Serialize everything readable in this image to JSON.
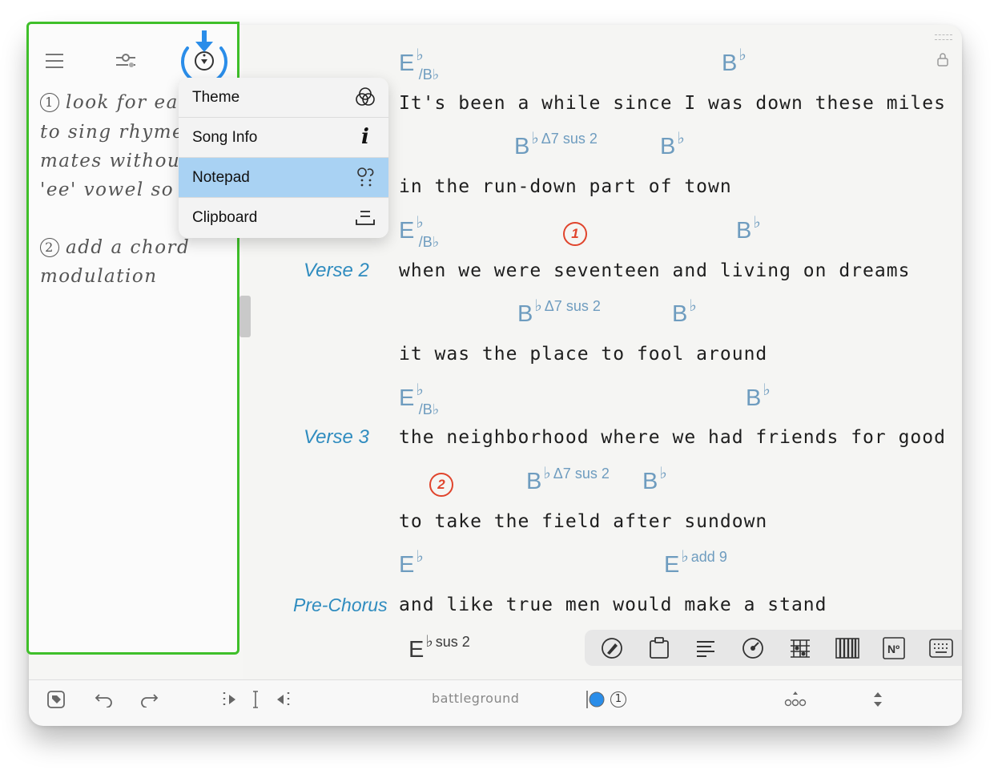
{
  "notepad": {
    "note1": "look for ea",
    "note1_num": "1",
    "note1_line2": "to sing rhyme",
    "note1_line3": "mates withou",
    "note1_line4": "'ee' vowel so",
    "note2": "add a chord",
    "note2_num": "2",
    "note2_line2": "modulation"
  },
  "menu": {
    "items": [
      {
        "label": "Theme",
        "icon": "theme-icon",
        "selected": false
      },
      {
        "label": "Song Info",
        "icon": "info-icon",
        "selected": false
      },
      {
        "label": "Notepad",
        "icon": "notepad-icon",
        "selected": true
      },
      {
        "label": "Clipboard",
        "icon": "clipboard-icon",
        "selected": false
      }
    ]
  },
  "sheet": {
    "lines": [
      {
        "lyric": "It's been a while since I was down these miles"
      },
      {
        "lyric": "in the run-down part of town"
      },
      {
        "lyric": "when we were seventeen and living on dreams",
        "section": "Verse 2"
      },
      {
        "lyric": "it was the place to fool around"
      },
      {
        "lyric": "the neighborhood where we had friends for good",
        "section": "Verse 3"
      },
      {
        "lyric": "to take the field after sundown"
      },
      {
        "lyric": "and like true men would make a stand",
        "section": "Pre-Chorus"
      }
    ],
    "chords": {
      "E": "E",
      "B": "B",
      "flat": "♭",
      "slash_bb": "/B♭",
      "maj7sus2": "Δ7 sus 2",
      "add9": "add 9",
      "sus2": "sus 2"
    },
    "markers": [
      "1",
      "2"
    ]
  },
  "bottom": {
    "song_title": "battleground",
    "page_num": "1"
  },
  "colors": {
    "accent": "#2f8cbf",
    "chord": "#6e9cbf",
    "marker": "#e0442c",
    "sidebar_border": "#3fbf2a",
    "selected": "#a9d2f3",
    "arrow": "#2a8de9"
  }
}
